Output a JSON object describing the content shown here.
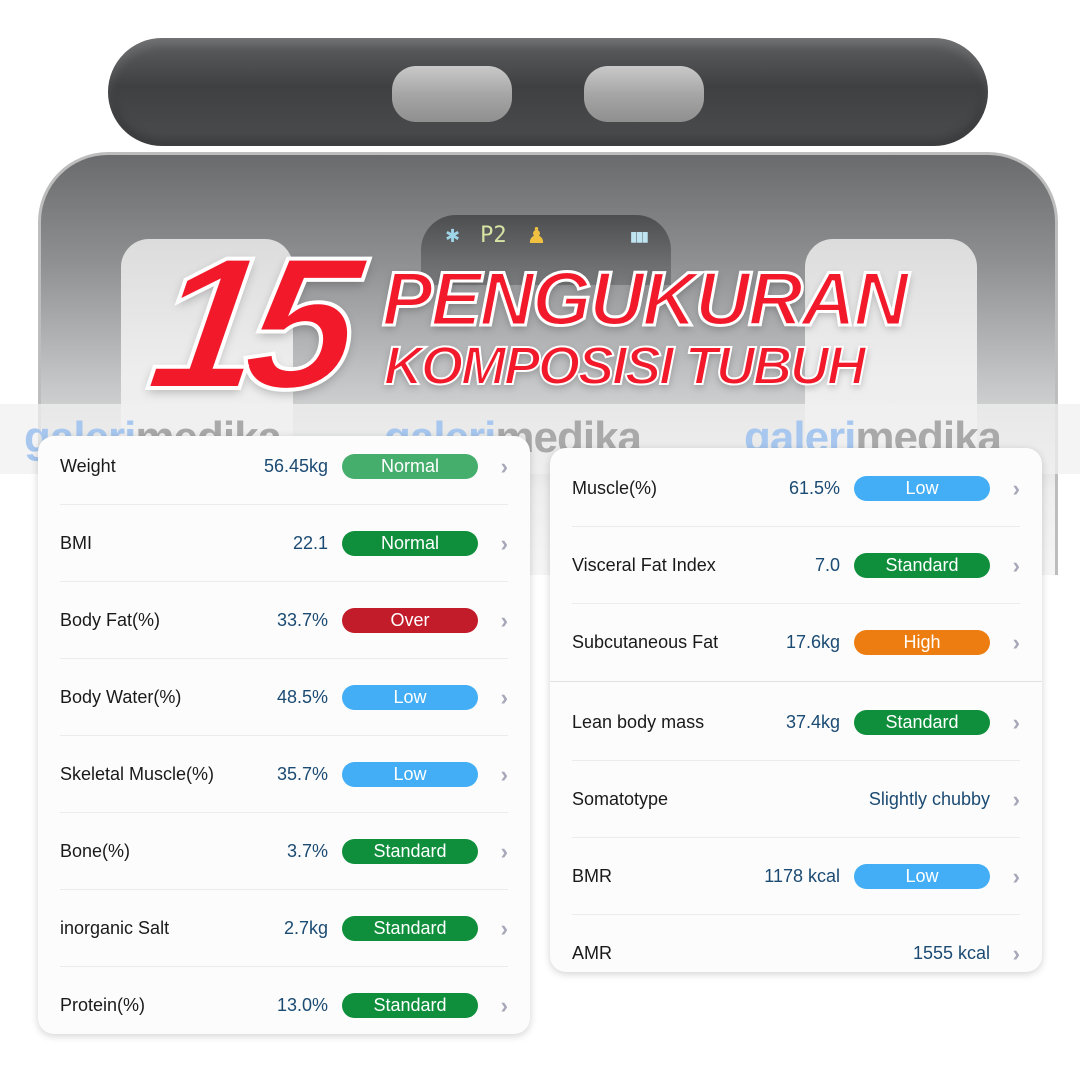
{
  "colors": {
    "headline": "#f2192b",
    "status_normal_light": "#46ae6c",
    "status_normal": "#0f8f3c",
    "status_over": "#c21b2a",
    "status_low": "#43aef5",
    "status_standard": "#0f8f3c",
    "status_high": "#ed7d10",
    "value_text": "#1b4a73",
    "chevron": "#a6a7b8"
  },
  "device": {
    "lcd": {
      "bluetooth_icon": "bluetooth-icon",
      "profile": "P2",
      "person_icon": "person-icon",
      "battery_icon": "battery-icon"
    }
  },
  "headline": {
    "number": "15",
    "line1": "PENGUKURAN",
    "line2": "KOMPOSISI TUBUH"
  },
  "watermark": {
    "part1": "galeri",
    "part2": "medika"
  },
  "left_card": {
    "rows": [
      {
        "label": "Weight",
        "value": "56.45kg",
        "status": "Normal",
        "status_color": "#46ae6c"
      },
      {
        "label": "BMI",
        "value": "22.1",
        "status": "Normal",
        "status_color": "#0f8f3c"
      },
      {
        "label": "Body Fat(%)",
        "value": "33.7%",
        "status": "Over",
        "status_color": "#c21b2a"
      },
      {
        "label": "Body Water(%)",
        "value": "48.5%",
        "status": "Low",
        "status_color": "#43aef5"
      },
      {
        "label": "Skeletal Muscle(%)",
        "value": "35.7%",
        "status": "Low",
        "status_color": "#43aef5"
      },
      {
        "label": "Bone(%)",
        "value": "3.7%",
        "status": "Standard",
        "status_color": "#0f8f3c"
      },
      {
        "label": "inorganic Salt",
        "value": "2.7kg",
        "status": "Standard",
        "status_color": "#0f8f3c"
      },
      {
        "label": "Protein(%)",
        "value": "13.0%",
        "status": "Standard",
        "status_color": "#0f8f3c"
      }
    ]
  },
  "right_card": {
    "rows": [
      {
        "label": "Muscle(%)",
        "value": "61.5%",
        "status": "Low",
        "status_color": "#43aef5"
      },
      {
        "label": "Visceral Fat Index",
        "value": "7.0",
        "status": "Standard",
        "status_color": "#0f8f3c"
      },
      {
        "label": "Subcutaneous Fat",
        "value": "17.6kg",
        "status": "High",
        "status_color": "#ed7d10"
      },
      {
        "label": "Lean body mass",
        "value": "37.4kg",
        "status": "Standard",
        "status_color": "#0f8f3c"
      },
      {
        "label": "Somatotype",
        "value": "Slightly chubby",
        "status": null,
        "status_color": null
      },
      {
        "label": "BMR",
        "value": "1178 kcal",
        "status": "Low",
        "status_color": "#43aef5"
      },
      {
        "label": "AMR",
        "value": "1555 kcal",
        "status": null,
        "status_color": null
      }
    ]
  },
  "chevron_glyph": "›"
}
